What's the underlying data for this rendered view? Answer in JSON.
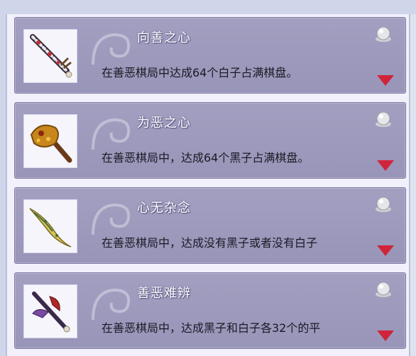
{
  "achievements": [
    {
      "title": "向善之心",
      "description": "在善恶棋局中达成64个白子占满棋盘。",
      "icon": "white-spotted-sword-icon"
    },
    {
      "title": "为恶之心",
      "description": "在善恶棋局中，达成64个黑子占满棋盘。",
      "icon": "golden-hammer-icon"
    },
    {
      "title": "心无杂念",
      "description": "在善恶棋局中，达成没有黑子或者没有白子",
      "icon": "jade-dagger-icon"
    },
    {
      "title": "善恶难辨",
      "description": "在善恶棋局中，达成黑子和白子各32个的平",
      "icon": "red-purple-axe-icon"
    }
  ],
  "colors": {
    "card": "#9895b8",
    "arrow": "#d0243a",
    "title_text": "#ffffff"
  }
}
